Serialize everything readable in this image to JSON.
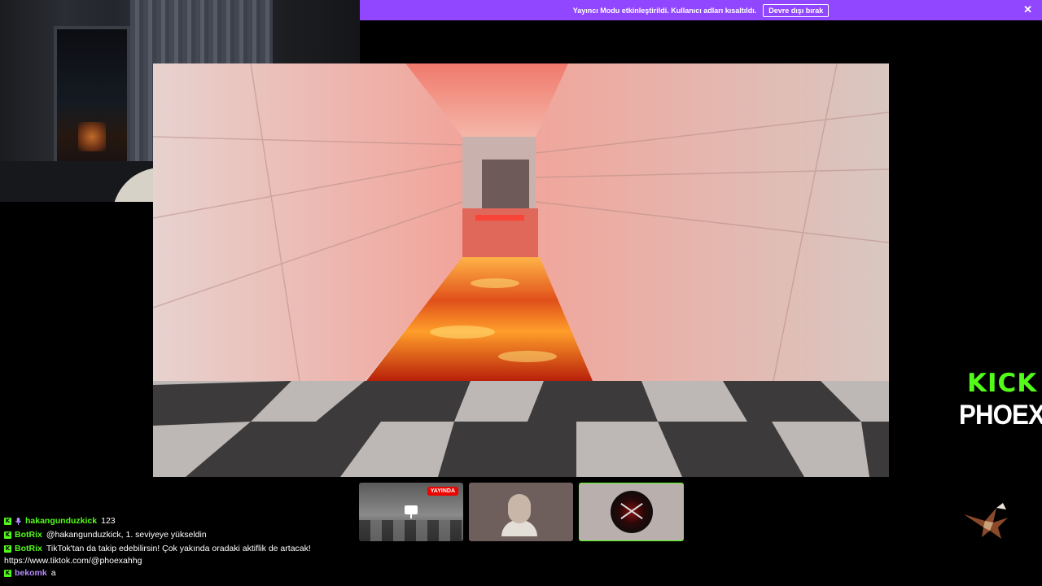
{
  "banner": {
    "message": "Yayıncı Modu etkinleştirildi. Kullanıcı adları kısaltıldı.",
    "disable_label": "Devre dışı bırak",
    "close_icon": "close-icon",
    "background": "#9146ff"
  },
  "branding": {
    "logo_text": "KICK",
    "channel_name": "PHOEXA",
    "accent": "#53fc18"
  },
  "thumbnails": [
    {
      "name": "game-screen",
      "badge": "YAYINDA",
      "icon": "monitor-icon"
    },
    {
      "name": "webcam",
      "icon": "camera-feed"
    },
    {
      "name": "avatar",
      "icon": "avatar-image",
      "selected": true
    }
  ],
  "chat": {
    "messages": [
      {
        "username": "hakangunduzkick",
        "text": "123",
        "badges": [
          "kick-badge",
          "mic-icon"
        ],
        "color": "#53fc18"
      },
      {
        "username": "BotRix",
        "text": "@hakangunduzkick, 1. seviyeye yükseldin",
        "badges": [
          "kick-badge"
        ],
        "color": "#53fc18"
      },
      {
        "username": "BotRix",
        "text": "TikTok'tan da takip edebilirsin! Çok yakında oradaki aktiflik de artacak!",
        "continuation": "https://www.tiktok.com/@phoexahhg",
        "badges": [
          "kick-badge"
        ],
        "color": "#53fc18"
      },
      {
        "username": "bekomk",
        "text": "a",
        "badges": [
          "kick-badge"
        ],
        "color": "#b78cff"
      }
    ]
  }
}
